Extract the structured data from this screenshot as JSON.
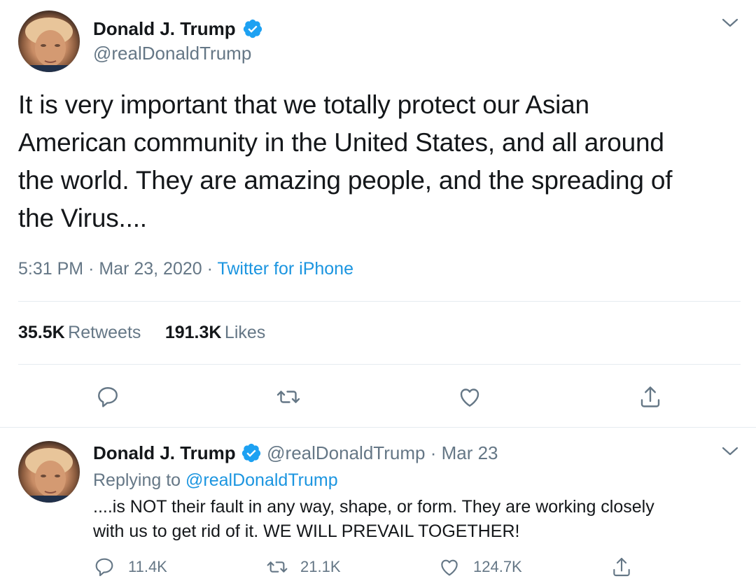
{
  "main_tweet": {
    "author_name": "Donald J. Trump",
    "handle": "@realDonaldTrump",
    "text_lines": [
      "It is very important that we totally protect our Asian",
      "American community in the United States, and all around",
      "the world. They are amazing people, and the spreading of",
      "the Virus...."
    ],
    "time": "5:31 PM",
    "date": "Mar 23, 2020",
    "separator": "·",
    "source": "Twitter for iPhone",
    "retweets_count": "35.5K",
    "retweets_label": "Retweets",
    "likes_count": "191.3K",
    "likes_label": "Likes"
  },
  "reply_tweet": {
    "author_name": "Donald J. Trump",
    "handle": "@realDonaldTrump",
    "separator": "·",
    "date": "Mar 23",
    "replying_prefix": "Replying to",
    "replying_to": "@realDonaldTrump",
    "text_lines": [
      "....is NOT their fault in any way, shape, or form. They are working closely",
      "with us to get rid of it. WE WILL PREVAIL TOGETHER!"
    ],
    "reply_count": "11.4K",
    "retweet_count": "21.1K",
    "like_count": "124.7K"
  },
  "icons": [
    "verified-badge-icon",
    "chevron-down-icon",
    "reply-icon",
    "retweet-icon",
    "like-icon",
    "share-icon"
  ],
  "colors": {
    "link": "#1b95e0",
    "muted": "#657786",
    "text": "#14171a",
    "divider": "#e6ecf0"
  }
}
